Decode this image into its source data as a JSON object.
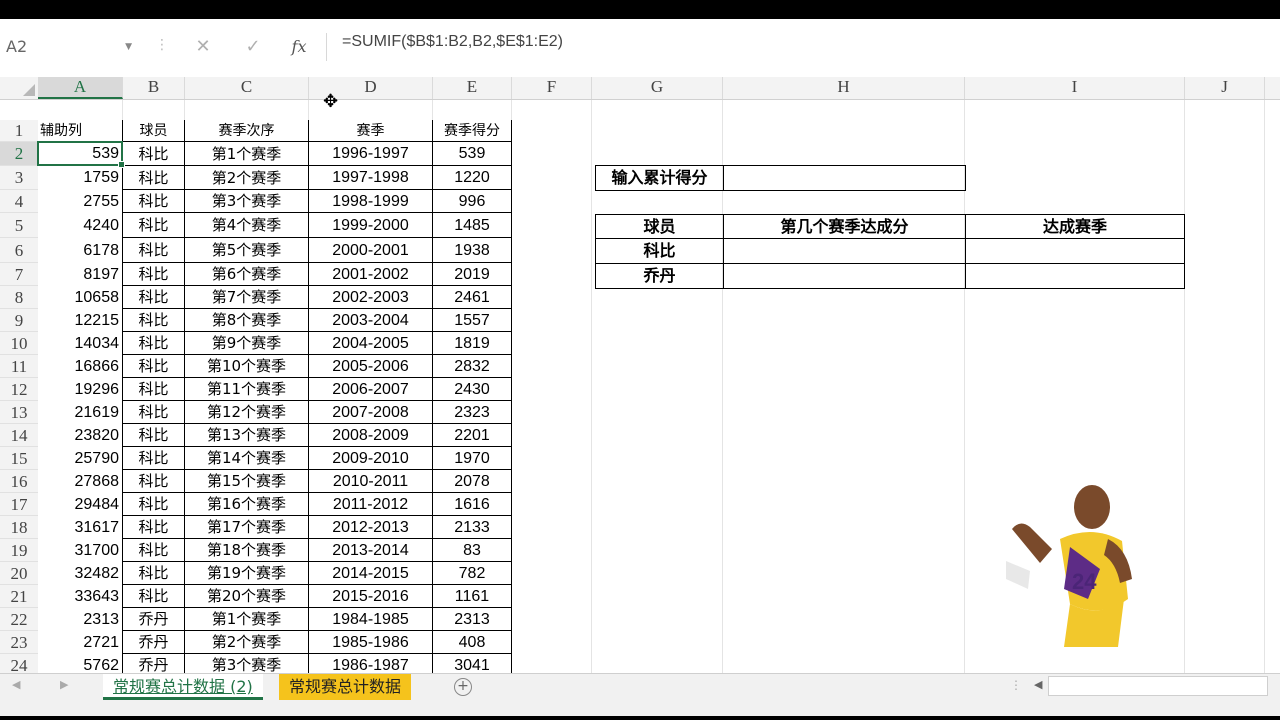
{
  "formula_bar": {
    "name_box": "A2",
    "cancel_glyph": "✕",
    "enter_glyph": "✓",
    "fx_label": "fx",
    "formula": "=SUMIF($B$1:B2,B2,$E$1:E2)"
  },
  "columns": [
    "A",
    "B",
    "C",
    "D",
    "E",
    "F",
    "G",
    "H",
    "I",
    "J"
  ],
  "rows": [
    "1",
    "2",
    "3",
    "4",
    "5",
    "6",
    "7",
    "8",
    "9",
    "10",
    "11",
    "12",
    "13",
    "14",
    "15",
    "16",
    "17",
    "18",
    "19",
    "20",
    "21",
    "22",
    "23",
    "24"
  ],
  "table": {
    "headers": [
      "辅助列",
      "球员",
      "赛季次序",
      "赛季",
      "赛季得分"
    ],
    "rows": [
      [
        "539",
        "科比",
        "第1个赛季",
        "1996-1997",
        "539"
      ],
      [
        "1759",
        "科比",
        "第2个赛季",
        "1997-1998",
        "1220"
      ],
      [
        "2755",
        "科比",
        "第3个赛季",
        "1998-1999",
        "996"
      ],
      [
        "4240",
        "科比",
        "第4个赛季",
        "1999-2000",
        "1485"
      ],
      [
        "6178",
        "科比",
        "第5个赛季",
        "2000-2001",
        "1938"
      ],
      [
        "8197",
        "科比",
        "第6个赛季",
        "2001-2002",
        "2019"
      ],
      [
        "10658",
        "科比",
        "第7个赛季",
        "2002-2003",
        "2461"
      ],
      [
        "12215",
        "科比",
        "第8个赛季",
        "2003-2004",
        "1557"
      ],
      [
        "14034",
        "科比",
        "第9个赛季",
        "2004-2005",
        "1819"
      ],
      [
        "16866",
        "科比",
        "第10个赛季",
        "2005-2006",
        "2832"
      ],
      [
        "19296",
        "科比",
        "第11个赛季",
        "2006-2007",
        "2430"
      ],
      [
        "21619",
        "科比",
        "第12个赛季",
        "2007-2008",
        "2323"
      ],
      [
        "23820",
        "科比",
        "第13个赛季",
        "2008-2009",
        "2201"
      ],
      [
        "25790",
        "科比",
        "第14个赛季",
        "2009-2010",
        "1970"
      ],
      [
        "27868",
        "科比",
        "第15个赛季",
        "2010-2011",
        "2078"
      ],
      [
        "29484",
        "科比",
        "第16个赛季",
        "2011-2012",
        "1616"
      ],
      [
        "31617",
        "科比",
        "第17个赛季",
        "2012-2013",
        "2133"
      ],
      [
        "31700",
        "科比",
        "第18个赛季",
        "2013-2014",
        "83"
      ],
      [
        "32482",
        "科比",
        "第19个赛季",
        "2014-2015",
        "782"
      ],
      [
        "33643",
        "科比",
        "第20个赛季",
        "2015-2016",
        "1161"
      ],
      [
        "2313",
        "乔丹",
        "第1个赛季",
        "1984-1985",
        "2313"
      ],
      [
        "2721",
        "乔丹",
        "第2个赛季",
        "1985-1986",
        "408"
      ],
      [
        "5762",
        "乔丹",
        "第3个赛季",
        "1986-1987",
        "3041"
      ]
    ]
  },
  "lookup": {
    "input_label": "输入累计得分",
    "input_value": "",
    "headers": [
      "球员",
      "第几个赛季达成分",
      "达成赛季"
    ],
    "players": [
      "科比",
      "乔丹"
    ]
  },
  "sheets": {
    "active": "常规赛总计数据 (2)",
    "other": "常规赛总计数据",
    "add_glyph": "+"
  },
  "colors": {
    "accent": "#217346",
    "tab_highlight": "#f5c31c"
  }
}
